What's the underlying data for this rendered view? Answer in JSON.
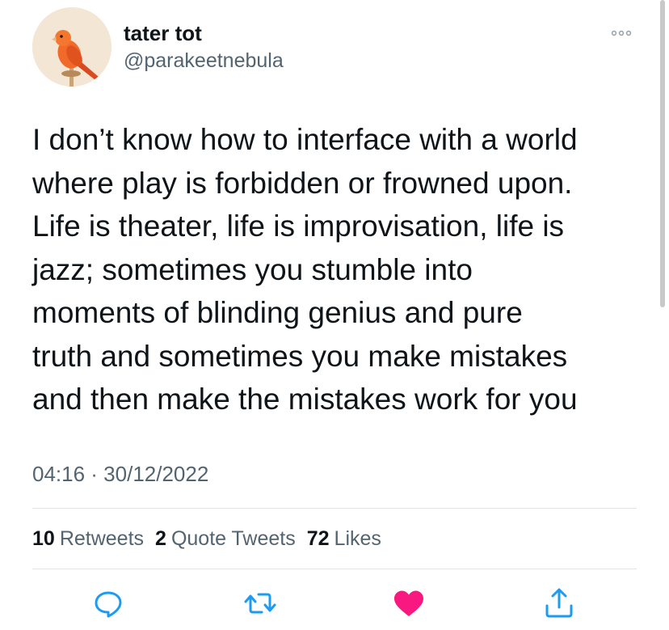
{
  "tweet": {
    "author": {
      "display_name": "tater tot",
      "handle": "@parakeetnebula",
      "avatar_icon": "orange-parakeet-avatar"
    },
    "text_lines": [
      "I don’t know how to interface with a world",
      "where play is forbidden or frowned upon.",
      "Life is theater, life is improvisation, life is",
      "jazz; sometimes you stumble into",
      "moments of blinding genius and pure",
      "truth and sometimes you make mistakes",
      "and then make the mistakes work for you"
    ],
    "timestamp": "04:16 · 30/12/2022",
    "stats": {
      "retweets": {
        "count": "10",
        "label": "Retweets"
      },
      "quote_tweets": {
        "count": "2",
        "label": "Quote Tweets"
      },
      "likes": {
        "count": "72",
        "label": "Likes"
      }
    },
    "actions": [
      "reply-icon",
      "retweet-icon",
      "like-icon",
      "share-icon"
    ],
    "liked": true
  },
  "colors": {
    "text_primary": "#0f1419",
    "text_secondary": "#536471",
    "action_icon": "#1d9bf0",
    "like_active": "#f91880",
    "divider": "#e1e5e8"
  }
}
